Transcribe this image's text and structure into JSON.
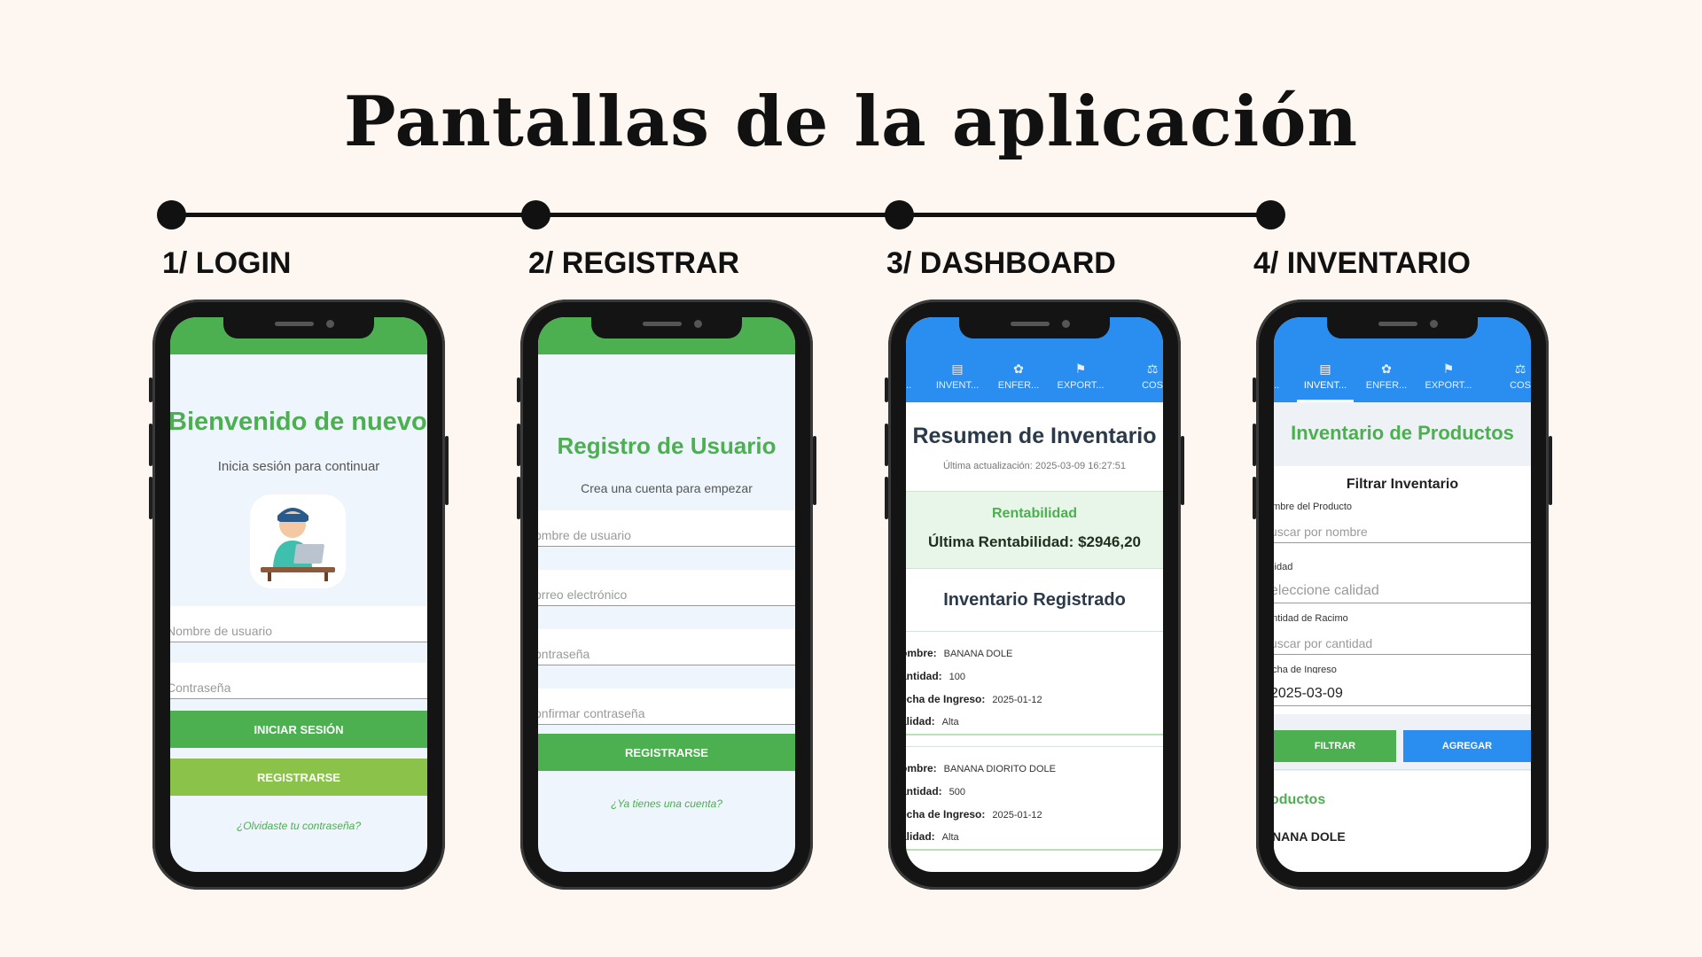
{
  "title": "Pantallas de la aplicación",
  "steps": [
    "1/ LOGIN",
    "2/ REGISTRAR",
    "3/ DASHBOARD",
    "4/ INVENTARIO"
  ],
  "login": {
    "welcome": "Bienvenido de nuevo",
    "subtitle": "Inicia sesión para continuar",
    "avatar_icon": "user-laptop-icon",
    "username_placeholder": "Nombre de usuario",
    "password_placeholder": "Contraseña",
    "login_button": "INICIAR SESIÓN",
    "register_button": "REGISTRARSE",
    "forgot_link": "¿Olvidaste tu contraseña?"
  },
  "register": {
    "title": "Registro de Usuario",
    "subtitle": "Crea una cuenta para empezar",
    "username_placeholder": "ombre de usuario",
    "email_placeholder": "orreo electrónico",
    "password_placeholder": "ontraseña",
    "confirm_placeholder": "onfirmar contraseña",
    "register_button": "REGISTRARSE",
    "have_account_link": "¿Ya tienes una cuenta?"
  },
  "tabs": [
    "HB...",
    "INVENT...",
    "ENFER...",
    "EXPORT...",
    "COS"
  ],
  "dashboard": {
    "title": "Resumen de Inventario",
    "updated": "Última actualización: 2025-03-09 16:27:51",
    "profit_label": "Rentabilidad",
    "profit_value": "Última Rentabilidad: $2946,20",
    "registered_title": "Inventario Registrado",
    "records": [
      {
        "nombre": "BANANA DOLE",
        "cantidad": "100",
        "fecha": "2025-01-12",
        "calidad": "Alta"
      },
      {
        "nombre": "BANANA DIORITO DOLE",
        "cantidad": "500",
        "fecha": "2025-01-12",
        "calidad": "Alta"
      }
    ],
    "keys": {
      "nombre": "ombre:",
      "cantidad": "antidad:",
      "fecha": "echa de Ingreso:",
      "calidad": "alidad:"
    }
  },
  "inventory": {
    "title": "Inventario de Productos",
    "filter_title": "Filtrar Inventario",
    "name_label": "ombre del Producto",
    "name_placeholder": "uscar por nombre",
    "quality_label": "alidad",
    "quality_placeholder": "eleccione calidad",
    "qty_label": "antidad de Racimo",
    "qty_placeholder": "uscar por cantidad",
    "date_label": "echa de Ingreso",
    "date_value": "2025-03-09",
    "filter_button": "FILTRAR",
    "add_button": "AGREGAR",
    "products_title": "oductos",
    "first_product": "NANA DOLE"
  },
  "colors": {
    "green": "#4caf50",
    "light_green": "#8bc34a",
    "blue": "#2a8ef0",
    "text_green": "#4caf50"
  }
}
